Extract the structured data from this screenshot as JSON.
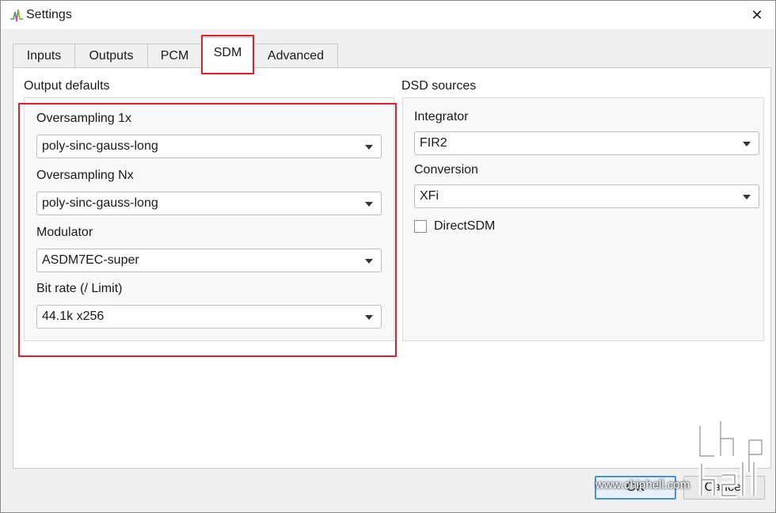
{
  "window": {
    "title": "Settings",
    "close_glyph": "✕"
  },
  "tabs": [
    {
      "label": "Inputs"
    },
    {
      "label": "Outputs"
    },
    {
      "label": "PCM"
    },
    {
      "label": "SDM",
      "active": true
    },
    {
      "label": "Advanced"
    }
  ],
  "output_defaults": {
    "title": "Output defaults",
    "oversampling_1x": {
      "label": "Oversampling 1x",
      "value": "poly-sinc-gauss-long"
    },
    "oversampling_nx": {
      "label": "Oversampling Nx",
      "value": "poly-sinc-gauss-long"
    },
    "modulator": {
      "label": "Modulator",
      "value": "ASDM7EC-super"
    },
    "bit_rate": {
      "label": "Bit rate (/ Limit)",
      "value": "44.1k x256"
    }
  },
  "dsd_sources": {
    "title": "DSD sources",
    "integrator": {
      "label": "Integrator",
      "value": "FIR2"
    },
    "conversion": {
      "label": "Conversion",
      "value": "XFi"
    },
    "direct_sdm": {
      "label": "DirectSDM",
      "checked": false
    }
  },
  "buttons": {
    "ok": "OK",
    "cancel": "Cancel"
  },
  "watermark": {
    "text": "www.chiphell.com"
  },
  "colors": {
    "highlight": "#e0202e",
    "default_button_border": "#4a90d9"
  }
}
